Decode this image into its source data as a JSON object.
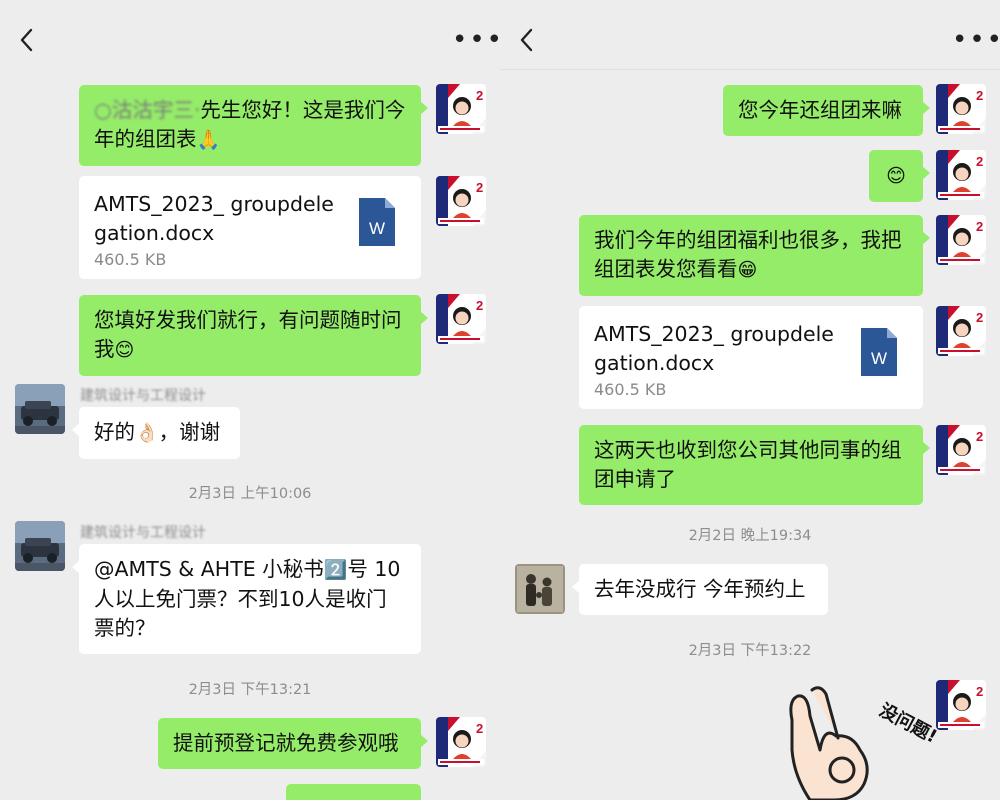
{
  "left": {
    "messages": {
      "m1_name": "○沽沽宇三·",
      "m1_text": "先生您好！这是我们今年的组团表",
      "m1_emoji": "🙏",
      "file_name": "AMTS_2023_ groupdelegation.docx",
      "file_size": "460.5 KB",
      "file_icon": "word-doc-icon",
      "m3_text": "您填好发我们就行，有问题随时问我",
      "m3_emoji": "😊",
      "sender1": "建筑设计与工程设计",
      "m4_text": "好的",
      "m4_emoji": "👌🏻",
      "m4_tail": "，谢谢",
      "time1": "2月3日 上午10:06",
      "sender2": "建筑设计与工程设计",
      "m5_text_a": "@AMTS & AHTE 小秘书",
      "m5_emoji": "2️⃣",
      "m5_text_b": "号 10人以上免门票？不到10人是收门票的？",
      "time2": "2月3日 下午13:21",
      "m6_text": "提前预登记就免费参观哦"
    }
  },
  "right": {
    "messages": {
      "r1_text": "您今年还组团来嘛",
      "r2_emoji": "😊",
      "r3_text": "我们今年的组团福利也很多，我把组团表发您看看",
      "r3_emoji": "😁",
      "file_name": "AMTS_2023_ groupdelegation.docx",
      "file_size": "460.5 KB",
      "r5_text": "这两天也收到您公司其他同事的组团申请了",
      "time1": "2月2日 晚上19:34",
      "r6_text": "去年没成行 今年预约上",
      "time2": "2月3日 下午13:22",
      "sticker_text": "没问题!"
    }
  },
  "icons": {
    "back": "back-chevron-icon",
    "more": "more-dots-icon"
  },
  "colors": {
    "background": "#ededed",
    "outgoing_bubble": "#95ec69",
    "incoming_bubble": "#ffffff",
    "word_icon": "#2b5797"
  }
}
